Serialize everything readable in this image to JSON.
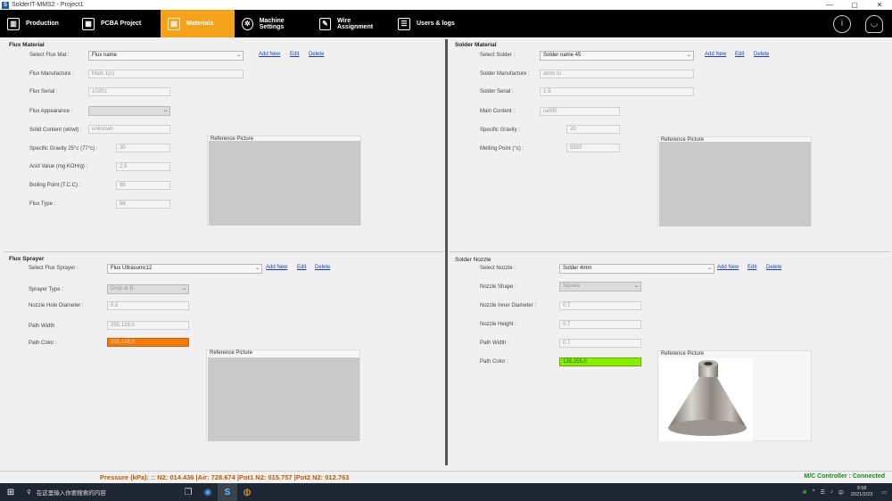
{
  "window": {
    "title": "SolderIT-MMS2 - Project1",
    "buttons": [
      "—",
      "▢",
      "✕"
    ]
  },
  "nav": {
    "tabs": [
      {
        "label": "Production",
        "icon": "production-icon"
      },
      {
        "label": "PCBA Project",
        "icon": "pcb-icon"
      },
      {
        "label": "Materials",
        "icon": "materials-icon"
      },
      {
        "label": "Machine Settings",
        "icon": "gear-icon"
      },
      {
        "label": "Wire Assignment",
        "icon": "wire-icon"
      },
      {
        "label": "Users & logs",
        "icon": "users-icon"
      }
    ],
    "active": "Materials",
    "right_icons": [
      "info-icon",
      "user-icon"
    ]
  },
  "flux_material": {
    "title": "Flux Material",
    "select_label": "Select Flux Mat :",
    "select_value": "Flux name",
    "add": "Add New",
    "edit": "Edit",
    "delete": "Delete",
    "manufacture_label": "Flux Manufacture :",
    "manufacture_value": "Main 1(c)",
    "serial_label": "Flux Serial :",
    "serial_value": "10201",
    "appearance_label": "Flux Appearance :",
    "appearance_value": "",
    "solid_label": "Solid Content (wt/wt) :",
    "solid_value": "unknown",
    "gravity_label": "Specific Gravity 25°c (77°c) :",
    "gravity_value": "30",
    "acid_label": "Acid Value (mg KOH/g) :",
    "acid_value": "2.5",
    "boiling_label": "Boiling Point (T.C.C) :",
    "boiling_value": "88",
    "type_label": "Flux Type :",
    "type_value": "88",
    "ref_label": "Reference Picture"
  },
  "solder_material": {
    "title": "Solder Material",
    "select_label": "Select Solder :",
    "select_value": "Solder name 45",
    "add": "Add New",
    "edit": "Edit",
    "delete": "Delete",
    "manufacture_label": "Solder Manufacture :",
    "manufacture_value": "amm fu",
    "serial_label": "Solder Serial :",
    "serial_value": "1-5",
    "content_label": "Main Content :",
    "content_value": "ra000",
    "gravity_label": "Specific Gravity :",
    "gravity_value": "20",
    "melting_label": "Melting Point (°c) :",
    "melting_value": "5933",
    "ref_label": "Reference Picture"
  },
  "flux_sprayer": {
    "title": "Flux Sprayer",
    "select_label": "Select Flux Sprayer :",
    "select_value": "Flux Ultrasonic12",
    "add": "Add New",
    "edit": "Edit",
    "delete": "Delete",
    "type_label": "Sprayer Type :",
    "type_value": "Drop at B",
    "hole_label": "Nozzle Hole Diameter :",
    "hole_value": "0.5",
    "width_label": "Path Width",
    "width_value": "255,128,0",
    "color_label": "Path Color :",
    "color_value": "255,128,0",
    "color_hex": "#f07a10",
    "ref_label": "Reference Picture"
  },
  "solder_nozzle": {
    "title": "Solder Nozzle",
    "select_label": "Select Nozzle :",
    "select_value": "Solder 4mm",
    "add": "Add New",
    "edit": "Edit",
    "delete": "Delete",
    "shape_label": "Nozzle Shape :",
    "shape_value": "Square",
    "inner_label": "Nozzle Inner Diameter :",
    "inner_value": "0.7",
    "height_label": "Nozzle Height :",
    "height_value": "0.7",
    "width_label": "Path Width :",
    "width_value": "0.7",
    "color_label": "Path Color :",
    "color_value": "128,255,0",
    "color_hex": "#88f000",
    "ref_label": "Reference Picture"
  },
  "status": {
    "pressure": "Pressure (kPa): :: N2: 014.436 |Air: 728.674 |Pot1 N2: 015.757 |Pot2 N2: 012.763",
    "controller": "M/C Controller : Connected"
  },
  "taskbar": {
    "search_placeholder": "在这里输入你要搜索的内容",
    "time": "9:58",
    "date": "2021/2/23",
    "ime": "中"
  }
}
